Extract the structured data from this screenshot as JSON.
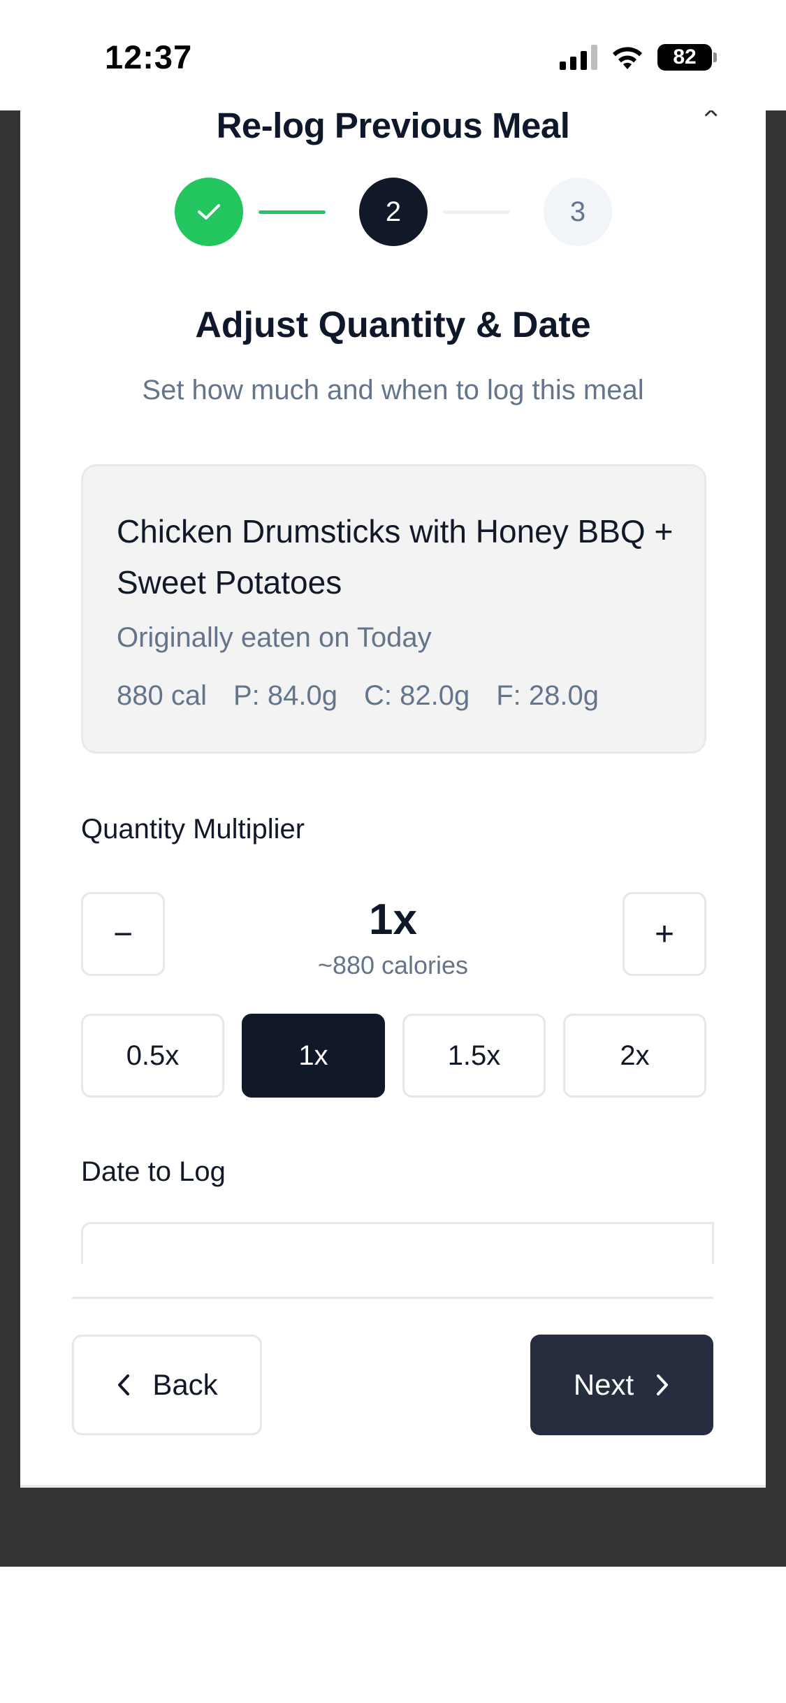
{
  "status_bar": {
    "time": "12:37",
    "battery": "82",
    "signal_icon": "cellular-signal-icon",
    "wifi_icon": "wifi-icon"
  },
  "modal": {
    "title": "Re-log Previous Meal",
    "close_icon": "close-icon",
    "steps": [
      {
        "state": "complete",
        "label": "",
        "icon": "check-icon"
      },
      {
        "state": "current",
        "label": "2"
      },
      {
        "state": "upcoming",
        "label": "3"
      }
    ]
  },
  "section": {
    "title": "Adjust Quantity & Date",
    "subtitle": "Set how much and when to log this meal"
  },
  "meal": {
    "name": "Chicken Drumsticks with Honey BBQ + Sweet Potatoes",
    "original_date": "Originally eaten on Today",
    "calories": "880 cal",
    "protein": "P: 84.0g",
    "carbs": "C: 82.0g",
    "fat": "F: 28.0g"
  },
  "quantity": {
    "label": "Quantity Multiplier",
    "value": "1x",
    "calories": "~880 calories",
    "decrement_label": "−",
    "increment_label": "+",
    "presets": [
      "0.5x",
      "1x",
      "1.5x",
      "2x"
    ],
    "selected": "1x"
  },
  "date": {
    "label": "Date to Log"
  },
  "footer": {
    "back_label": "Back",
    "next_label": "Next"
  },
  "colors": {
    "success": "#22c55e",
    "primary": "#111827",
    "next_button": "#262d3f",
    "muted_text": "#64748b",
    "backdrop": "#333333"
  }
}
